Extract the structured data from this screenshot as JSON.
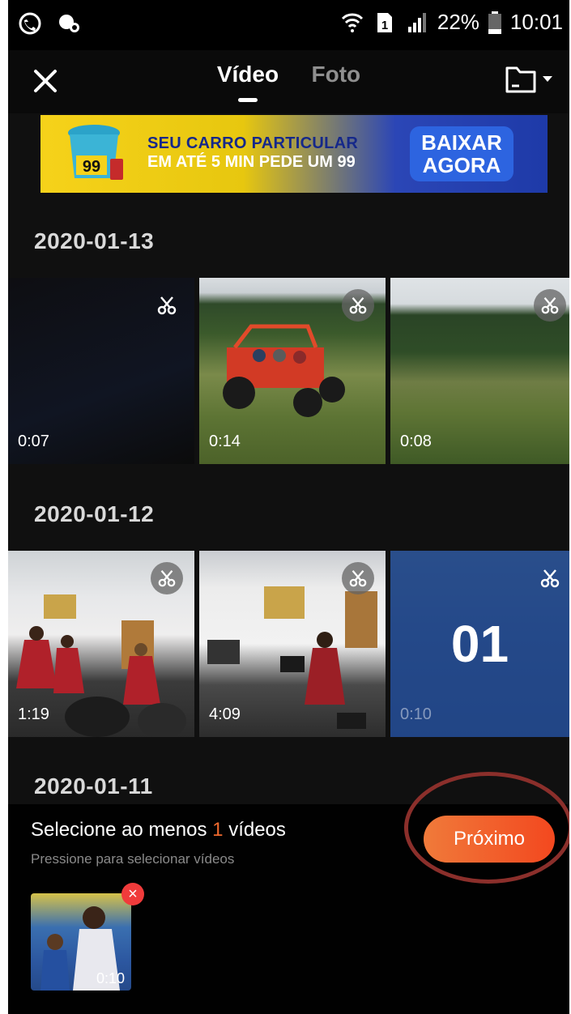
{
  "status_bar": {
    "battery": "22%",
    "time": "10:01"
  },
  "header": {
    "tabs": [
      {
        "label": "Vídeo",
        "active": true
      },
      {
        "label": "Foto",
        "active": false
      }
    ]
  },
  "ad": {
    "line1": "SEU CARRO PARTICULAR",
    "line2": "EM ATÉ 5 MIN PEDE UM 99",
    "button_line1": "BAIXAR",
    "button_line2": "AGORA",
    "logo": "99"
  },
  "sections": [
    {
      "date": "2020-01-13",
      "videos": [
        {
          "duration": "0:07"
        },
        {
          "duration": "0:14"
        },
        {
          "duration": "0:08"
        }
      ]
    },
    {
      "date": "2020-01-12",
      "videos": [
        {
          "duration": "1:19"
        },
        {
          "duration": "4:09"
        },
        {
          "duration": "0:10",
          "selected_index": "01"
        }
      ]
    },
    {
      "date": "2020-01-11",
      "videos": []
    }
  ],
  "bottom_panel": {
    "hint_prefix": "Selecione ao menos",
    "hint_count": "1",
    "hint_suffix": "vídeos",
    "sub_hint": "Pressione para selecionar vídeos",
    "next_label": "Próximo",
    "selected_thumb_duration": "0:10"
  },
  "colors": {
    "accent": "#f3481f",
    "highlight_circle": "#8b2f2b"
  },
  "icons": [
    "whatsapp-icon",
    "location-icon",
    "wifi-icon",
    "sim-icon",
    "signal-icon",
    "battery-icon",
    "close-icon",
    "folder-icon",
    "scissors-icon",
    "remove-icon"
  ]
}
